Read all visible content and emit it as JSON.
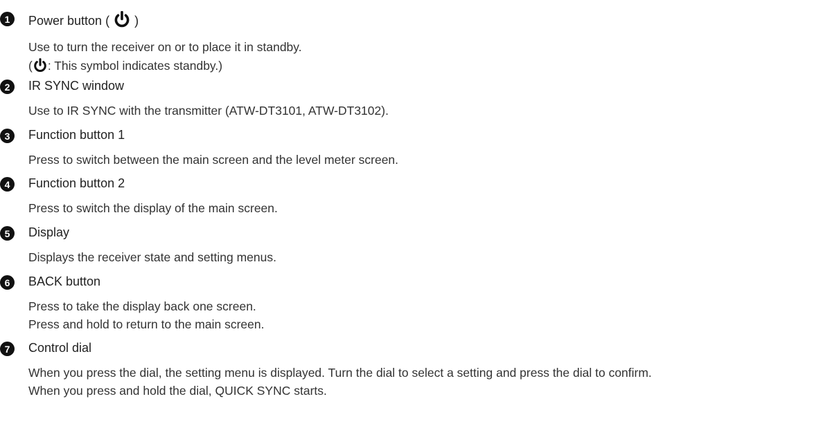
{
  "items": [
    {
      "number": "1",
      "title_prefix": "Power button ( ",
      "title_icon": "power-icon",
      "title_suffix": " )",
      "lines": [
        {
          "text": "Use to turn the receiver on or to place it in standby."
        },
        {
          "prefix": "(",
          "icon": "power-icon",
          "text": ": This symbol indicates standby.)"
        }
      ]
    },
    {
      "number": "2",
      "title": "IR SYNC window",
      "lines": [
        "Use to IR SYNC with the transmitter (ATW-DT3101, ATW-DT3102)."
      ]
    },
    {
      "number": "3",
      "title": "Function button 1",
      "lines": [
        "Press to switch between the main screen and the level meter screen."
      ]
    },
    {
      "number": "4",
      "title": "Function button 2",
      "lines": [
        "Press to switch the display of the main screen."
      ]
    },
    {
      "number": "5",
      "title": "Display",
      "lines": [
        "Displays the receiver state and setting menus."
      ]
    },
    {
      "number": "6",
      "title": "BACK button",
      "lines": [
        "Press to take the display back one screen.",
        "Press and hold to return to the main screen."
      ]
    },
    {
      "number": "7",
      "title": "Control dial",
      "lines": [
        "When you press the dial, the setting menu is displayed. Turn the dial to select a setting and press the dial to confirm.",
        "When you press and hold the dial, QUICK SYNC starts."
      ]
    }
  ]
}
